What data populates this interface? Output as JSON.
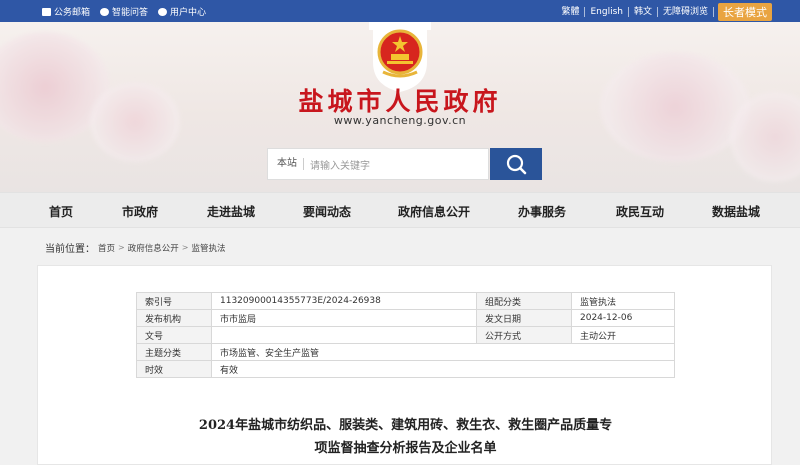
{
  "topbar": {
    "left_links": [
      "公务邮箱",
      "智能问答",
      "用户中心"
    ],
    "right_links": [
      "繁體",
      "English",
      "韩文",
      "无障碍浏览"
    ],
    "elder_mode": "长者模式"
  },
  "header": {
    "title": "盐城市人民政府",
    "url": "www.yancheng.gov.cn"
  },
  "search": {
    "scope": "本站",
    "placeholder": "请输入关键字"
  },
  "nav": {
    "items": [
      "首页",
      "市政府",
      "走进盐城",
      "要闻动态",
      "政府信息公开",
      "办事服务",
      "政民互动",
      "数据盐城"
    ]
  },
  "breadcrumb": {
    "label": "当前位置：",
    "items": [
      "首页",
      "政府信息公开",
      "监管执法"
    ]
  },
  "meta": {
    "index_label": "索引号",
    "index_value": "11320900014355773E/2024-26938",
    "category_label": "组配分类",
    "category_value": "监管执法",
    "publisher_label": "发布机构",
    "publisher_value": "市市监局",
    "date_label": "发文日期",
    "date_value": "2024-12-06",
    "docno_label": "文号",
    "docno_value": "",
    "method_label": "公开方式",
    "method_value": "主动公开",
    "topic_label": "主题分类",
    "topic_value": "市场监管、安全生产监管",
    "validity_label": "时效",
    "validity_value": "有效"
  },
  "document": {
    "title_line1": "2024年盐城市纺织品、服装类、建筑用砖、救生衣、救生圈产品质量专",
    "title_line2": "项监督抽查分析报告及企业名单"
  },
  "colors": {
    "topbar": "#2f57a6",
    "title_red": "#c8161d",
    "search_button": "#2a5499",
    "elder_button": "#e9a441"
  }
}
